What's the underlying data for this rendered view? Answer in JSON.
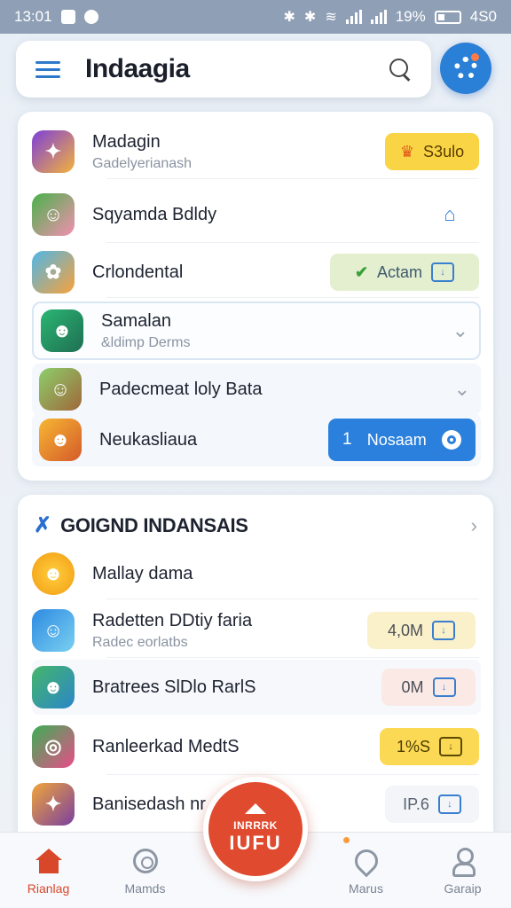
{
  "status_bar": {
    "time": "13:01",
    "battery": "19%",
    "right_text": "4S0"
  },
  "header": {
    "title": "Indaagia"
  },
  "card1": {
    "rows": [
      {
        "name": "Madagin",
        "sub": "Gadelyerianash",
        "action": {
          "label": "S3ulo",
          "icon": "crown-icon",
          "color": "#f9d545"
        }
      },
      {
        "name": "Sqyamda Bdldy",
        "sub": "",
        "action": {
          "icon": "home-icon"
        }
      },
      {
        "name": "Crlondental",
        "sub": "",
        "action": {
          "label": "Actam",
          "icon": "check-icon",
          "color": "#e4efcf"
        }
      },
      {
        "name": "Samalan",
        "sub": "&ldimp Derms",
        "action": {
          "icon": "chevron-down-icon"
        }
      },
      {
        "name": "Padecmeat loly Bata",
        "sub": "",
        "action": {
          "icon": "chevron-down-icon"
        }
      },
      {
        "name": "Neukasliaua",
        "sub": "",
        "action": {
          "count": "1",
          "label": "Nosaam",
          "color": "#2a80dc"
        }
      }
    ]
  },
  "card2": {
    "title": "GOIGND INDANSAIS",
    "rows": [
      {
        "name": "Mallay dama",
        "sub": "",
        "value": ""
      },
      {
        "name": "Radetten DDtiy faria",
        "sub": "Radec eorlatbs",
        "value": "4,0M",
        "color": "#faf0c9"
      },
      {
        "name": "Bratrees SlDlo RarlS",
        "sub": "",
        "value": "0M",
        "color": "#fbe9e6"
      },
      {
        "name": "Ranleerkad MedtS",
        "sub": "",
        "value": "1%S",
        "color": "#fbd954"
      },
      {
        "name": "Banisedash nr",
        "sub": "",
        "value": "IP.6",
        "color": "#f3f5f8"
      }
    ]
  },
  "bottom_nav": {
    "items": [
      {
        "label": "Rianlag",
        "icon": "home-icon"
      },
      {
        "label": "Mamds",
        "icon": "camera-icon"
      },
      {
        "label": "Marus",
        "icon": "location-icon"
      },
      {
        "label": "Garaip",
        "icon": "profile-icon"
      }
    ],
    "fab": {
      "top": "INRRRK",
      "main": "IUFU"
    }
  }
}
